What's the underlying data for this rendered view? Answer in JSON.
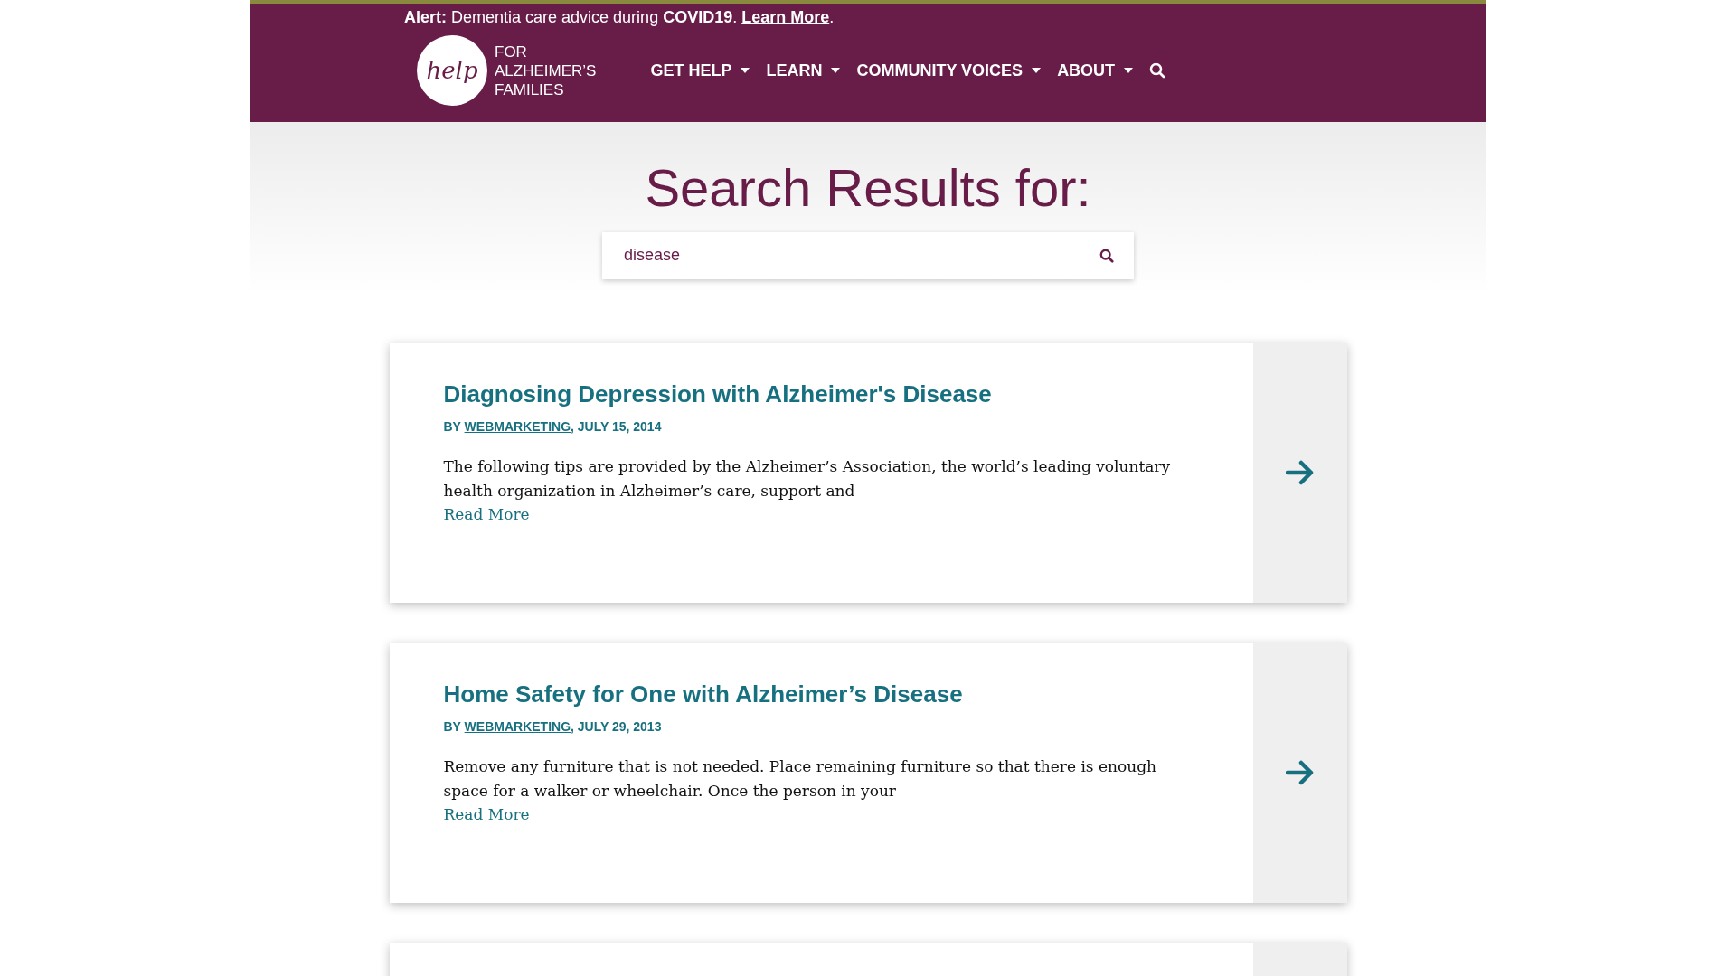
{
  "alert": {
    "text": "**Alert:** Dementia care advice during **COVID19**.",
    "link": "Learn More",
    "after": "."
  },
  "logo": {
    "mark": "help",
    "lines": [
      "FOR",
      "ALZHEIMER’S",
      "FAMILIES"
    ]
  },
  "nav": [
    {
      "label": "GET HELP",
      "dropdown": true
    },
    {
      "label": "LEARN",
      "dropdown": true
    },
    {
      "label": "COMMUNITY VOICES",
      "dropdown": true
    },
    {
      "label": "ABOUT",
      "dropdown": true
    }
  ],
  "hero": {
    "title": "Search Results for:",
    "search": {
      "value": "disease"
    }
  },
  "results": [
    {
      "title": "Diagnosing Depression with Alzheimer's Disease",
      "byline": {
        "prefix": "BY",
        "author": "WEBMARKETING",
        "date": ", JULY 15, 2014"
      },
      "excerpt": "The following tips are provided by the Alzheimer’s Association, the world’s leading voluntary health organization in Alzheimer’s care, support and",
      "link": "Read More"
    },
    {
      "title": "Home Safety for One with Alzheimer’s Disease",
      "byline": {
        "prefix": "BY",
        "author": "WEBMARKETING",
        "date": ", JULY 29, 2013"
      },
      "excerpt": "Remove any furniture that is not needed. Place remaining furniture so that there is enough space for a walker or wheelchair. Once the person in your",
      "link": "Read More"
    }
  ]
}
